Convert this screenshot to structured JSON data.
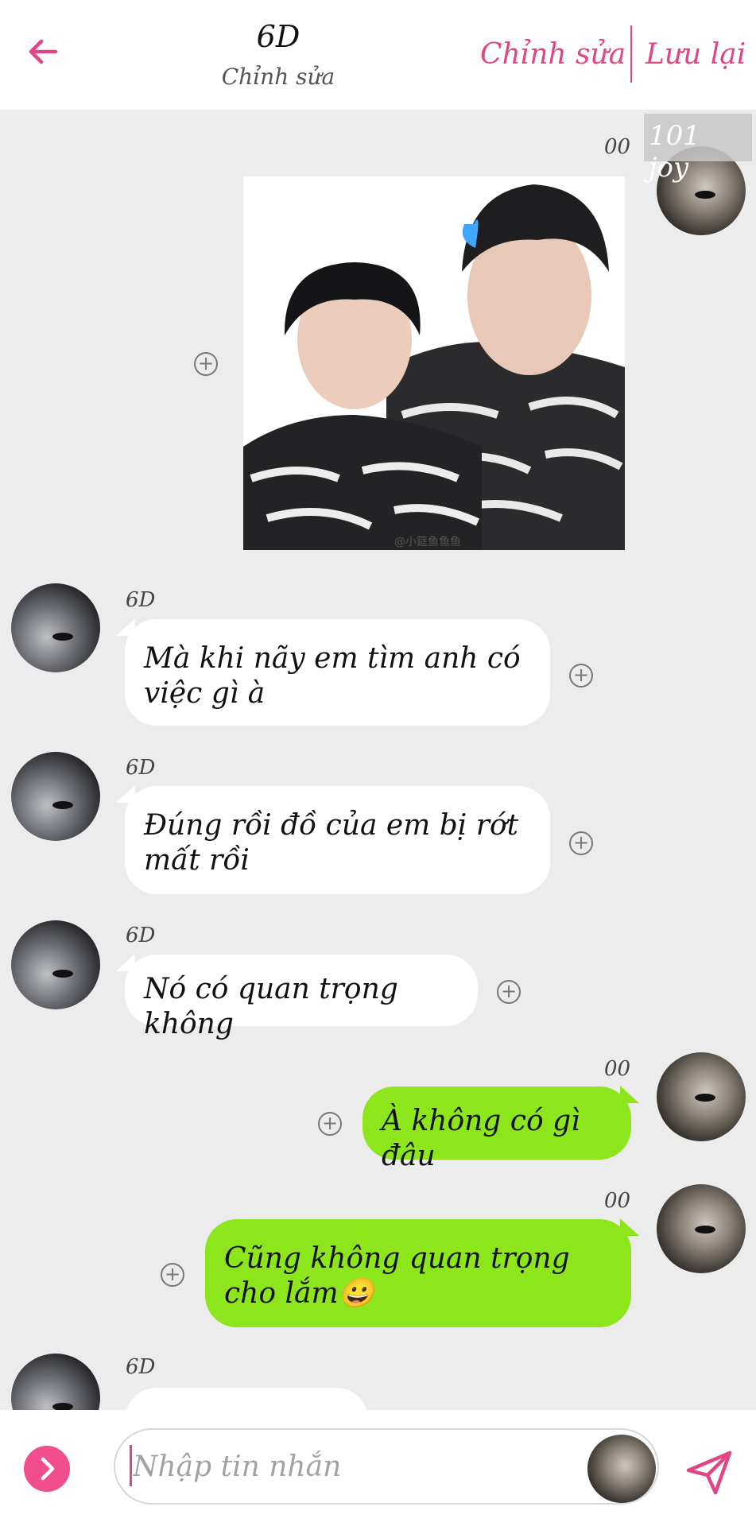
{
  "header": {
    "back_icon": "arrow-left-icon",
    "title": "6D",
    "subtitle": "Chỉnh sửa",
    "edit_label": "Chỉnh sửa",
    "save_label": "Lưu lại"
  },
  "colors": {
    "accent": "#e04585",
    "outgoing_bubble": "#8de51c",
    "incoming_bubble": "#ffffff",
    "background": "#ececec"
  },
  "watermark": "101 joy",
  "messages": [
    {
      "direction": "out",
      "sender": "00",
      "type": "image",
      "image_credit": "@小筵鱼鱼鱼"
    },
    {
      "direction": "in",
      "sender": "6D",
      "text": "Mà khi nãy em tìm anh có việc gì à"
    },
    {
      "direction": "in",
      "sender": "6D",
      "text": "Đúng rồi đồ của em bị rớt mất rồi"
    },
    {
      "direction": "in",
      "sender": "6D",
      "text": "Nó có quan trọng không"
    },
    {
      "direction": "out",
      "sender": "00",
      "text": "À không có gì đâu"
    },
    {
      "direction": "out",
      "sender": "00",
      "text": "Cũng không quan trọng cho lắm😀"
    },
    {
      "direction": "in",
      "sender": "6D",
      "text": ""
    }
  ],
  "input": {
    "placeholder": "Nhập tin nhắn",
    "value": "",
    "expand_icon": "chevron-right-icon",
    "send_icon": "send-icon"
  }
}
